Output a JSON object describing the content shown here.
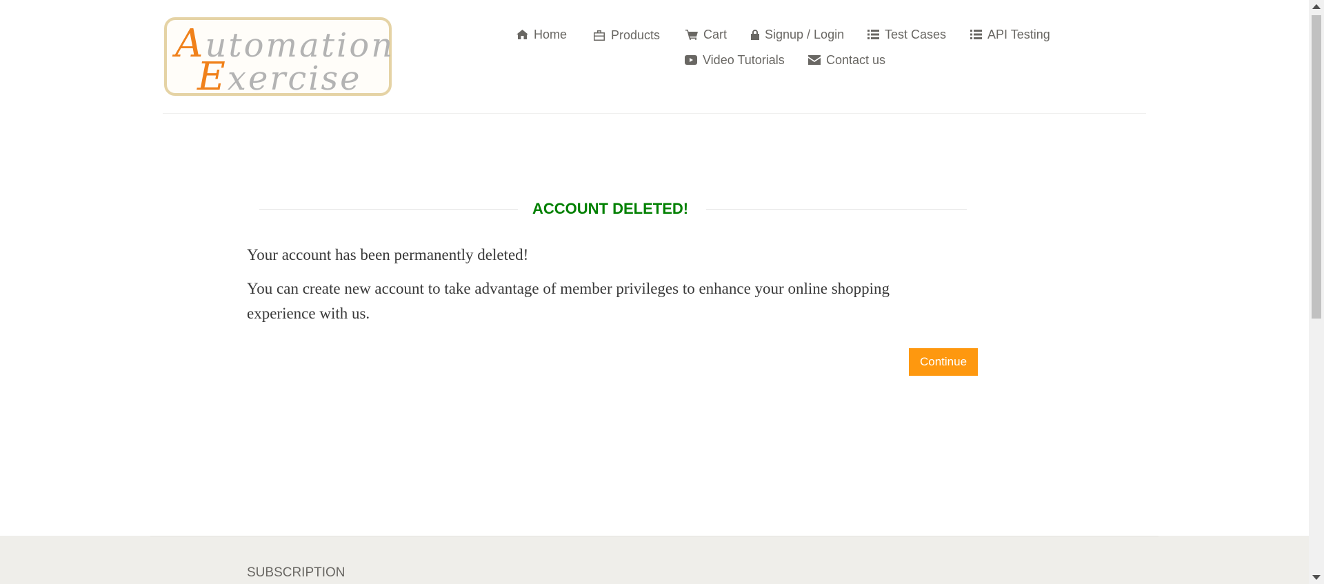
{
  "header": {
    "logo": {
      "first_cap": "A",
      "first_rest": "utomation",
      "second_cap": "E",
      "second_rest": "xercise"
    },
    "nav": {
      "home": "Home",
      "products": "Products",
      "cart": "Cart",
      "signup_login": "Signup / Login",
      "test_cases": "Test Cases",
      "api_testing": "API Testing",
      "video_tutorials": "Video Tutorials",
      "contact_us": "Contact us"
    },
    "icons": [
      "home-icon",
      "briefcase-icon",
      "cart-icon",
      "lock-icon",
      "list-icon",
      "list-icon",
      "youtube-icon",
      "envelope-icon"
    ]
  },
  "main": {
    "title": "ACCOUNT DELETED!",
    "message_1": "Your account has been permanently deleted!",
    "message_2": "You can create new account to take advantage of member privileges to enhance your online shopping experience with us.",
    "continue_label": "Continue"
  },
  "footer": {
    "subscription_heading": "SUBSCRIPTION"
  },
  "colors": {
    "accent": "#fe980f",
    "success": "#008000",
    "text": "#696763",
    "logo_orange": "#f0811b",
    "footer_bg": "#efeeea"
  }
}
